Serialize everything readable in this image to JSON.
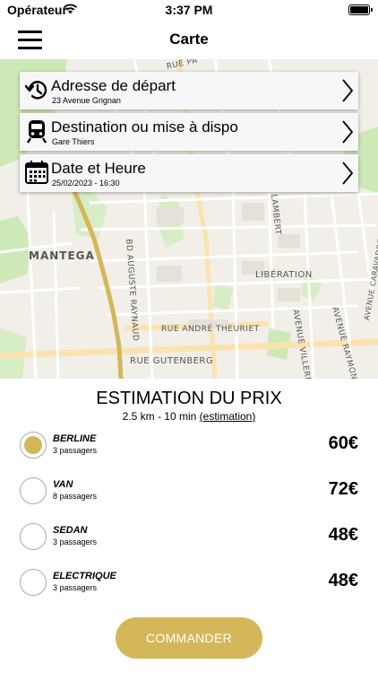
{
  "status_bar": {
    "carrier": "Opérateur",
    "time": "3:37 PM"
  },
  "nav": {
    "title": "Carte",
    "menu_icon": "hamburger-menu-icon"
  },
  "map": {
    "labels": {
      "mantega": "MANTEGA",
      "liberation": "LIBÉRATION",
      "gutenberg": "RUE GUTENBERG",
      "theuriet": "RUE ANDRÉ THEURIET",
      "auguste": "BD AUGUSTE RAYNAUD",
      "lambert": "LAMBERT",
      "villermont": "AVENUE VILLERM",
      "raymond": "AVENUE RAYMOND COM",
      "caravadossi": "AVENUE CARAVADOSSI",
      "rue_pa": "RUE PA"
    }
  },
  "cards": [
    {
      "title": "Adresse de départ",
      "subtitle": "23 Avenue Grignan",
      "icon": "history-icon"
    },
    {
      "title": "Destination ou mise à dispo",
      "subtitle": "Gare Thiers",
      "icon": "train-icon"
    },
    {
      "title": "Date et Heure",
      "subtitle": "25/02/2023 - 16:30",
      "icon": "calendar-icon"
    }
  ],
  "estimation": {
    "title": "ESTIMATION DU PRIX",
    "distance_time": "2.5 km - 10 min",
    "link": "(estimation)"
  },
  "vehicles": [
    {
      "name": "BERLINE",
      "passengers": "3 passagers",
      "price": "60€",
      "selected": true
    },
    {
      "name": "VAN",
      "passengers": "8 passagers",
      "price": "72€",
      "selected": false
    },
    {
      "name": "SEDAN",
      "passengers": "3 passagers",
      "price": "48€",
      "selected": false
    },
    {
      "name": "ELECTRIQUE",
      "passengers": "3 passagers",
      "price": "48€",
      "selected": false
    }
  ],
  "order_button": "COMMANDER",
  "colors": {
    "accent": "#d4b75a",
    "route": "#d4b75a",
    "map_bg": "#f2efe9",
    "park_green": "#c8e6b4"
  }
}
